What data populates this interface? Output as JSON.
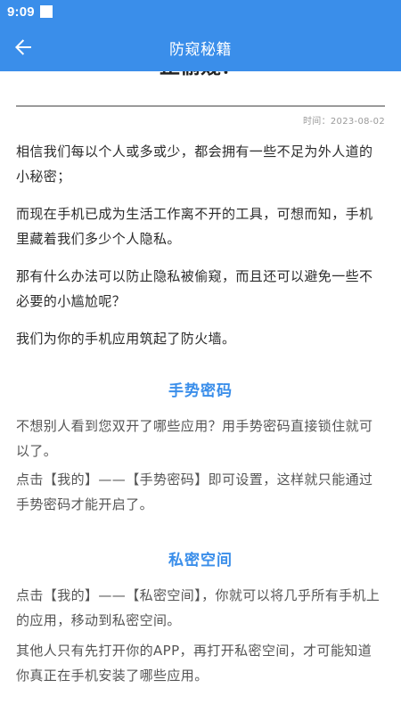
{
  "status_bar": {
    "time": "9:09"
  },
  "app_bar": {
    "title": "防窥秘籍",
    "back_icon": "arrow-left-icon"
  },
  "article": {
    "title_fragment": "止偷窥？",
    "date": "时间：2023-08-02",
    "intro": [
      "相信我们每以个人或多或少，都会拥有一些不足为外人道的小秘密；",
      "而现在手机已成为生活工作离不开的工具，可想而知，手机里藏着我们多少个人隐私。",
      "那有什么办法可以防止隐私被偷窥，而且还可以避免一些不必要的小尴尬呢？",
      "我们为你的手机应用筑起了防火墙。"
    ],
    "sections": [
      {
        "heading": "手势密码",
        "paragraphs": [
          "不想别人看到您双开了哪些应用？用手势密码直接锁住就可以了。",
          "点击【我的】——【手势密码】即可设置，这样就只能通过手势密码才能开启了。"
        ]
      },
      {
        "heading": "私密空间",
        "paragraphs": [
          "点击【我的】——【私密空间】，你就可以将几乎所有手机上的应用，移动到私密空间。",
          "其他人只有先打开你的APP，再打开私密空间，才可能知道你真正在手机安装了哪些应用。"
        ]
      }
    ]
  },
  "colors": {
    "accent": "#3a8eea",
    "body_text": "#2b2b2b",
    "divider": "#9a9a9a"
  }
}
